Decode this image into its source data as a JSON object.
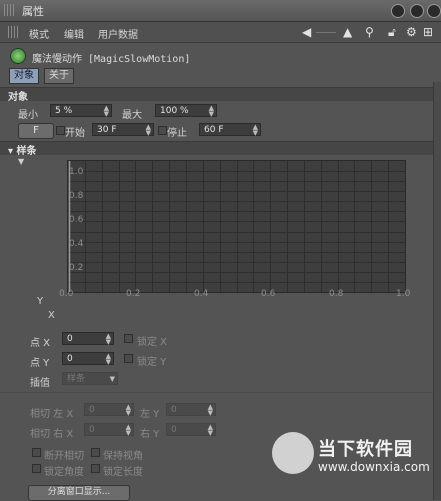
{
  "window": {
    "title": "属性"
  },
  "menu": {
    "items": [
      "模式",
      "编辑",
      "用户数据"
    ]
  },
  "toolbar": {
    "icons": [
      "arrow-left-icon",
      "arrow-up-icon",
      "search-icon",
      "lock-icon",
      "settings-icon",
      "add-panel-icon"
    ]
  },
  "object": {
    "title": "魔法慢动作 [MagicSlowMotion]",
    "tabs": [
      {
        "label": "对象",
        "active": true
      },
      {
        "label": "关于",
        "active": false
      }
    ]
  },
  "section_object": {
    "label": "对象"
  },
  "fields": {
    "min_label": "最小",
    "min_value": "5 %",
    "max_label": "最大",
    "max_value": "100 %",
    "f_button": "F",
    "start_label": "开始",
    "start_value": "30 F",
    "stop_label": "停止",
    "stop_value": "60 F"
  },
  "section_spline": {
    "label": "样条"
  },
  "spline": {
    "y_ticks": [
      "1.0",
      "0.8",
      "0.6",
      "0.4",
      "0.2"
    ],
    "x_ticks": [
      "0.0",
      "0.2",
      "0.4",
      "0.6",
      "0.8",
      "1.0"
    ],
    "y_axis_label": "Y",
    "x_axis_label": "X"
  },
  "point": {
    "x_label": "点 X",
    "x_value": "0",
    "lock_x_label": "锁定 X",
    "y_label": "点 Y",
    "y_value": "0",
    "lock_y_label": "锁定 Y",
    "interp_label": "插值",
    "interp_value": "样条"
  },
  "tangent": {
    "left_x_label": "相切 左 X",
    "left_x_value": "0",
    "left_y_label": "左 Y",
    "left_y_value": "0",
    "right_x_label": "相切 右 X",
    "right_x_value": "0",
    "right_y_label": "右 Y",
    "right_y_value": "0"
  },
  "options": {
    "break_tangent": "断开相切",
    "keep_angle": "保持视角",
    "lock_angle": "锁定角度",
    "lock_length": "锁定长度"
  },
  "detach_button": "分离窗口显示...",
  "watermark": {
    "main": "当下软件园",
    "url": "www.downxia.com"
  },
  "colors": {
    "panel": "#545454",
    "active_tab": "#8f9fb8",
    "graph_bg": "#3e3e3e",
    "accent_icon": "#3f8f3a"
  }
}
